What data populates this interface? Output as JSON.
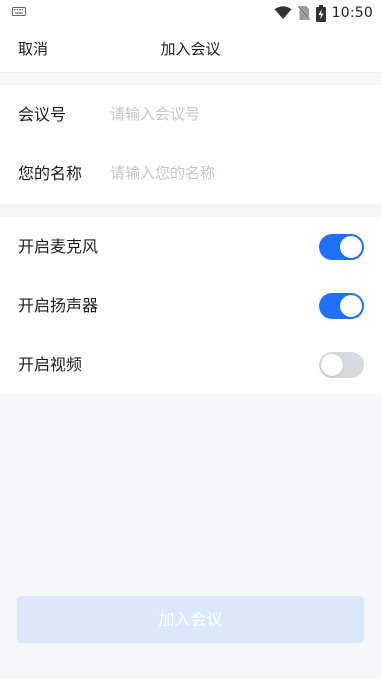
{
  "status_bar": {
    "time": "10:50",
    "icons": [
      "keyboard-icon",
      "wifi-icon",
      "no-sim-icon",
      "battery-charging-icon"
    ]
  },
  "nav": {
    "cancel_label": "取消",
    "title": "加入会议"
  },
  "form": {
    "meeting_id": {
      "label": "会议号",
      "value": "",
      "placeholder": "请输入会议号"
    },
    "name": {
      "label": "您的名称",
      "value": "",
      "placeholder": "请输入您的名称"
    }
  },
  "toggles": [
    {
      "label": "开启麦克风",
      "on": true
    },
    {
      "label": "开启扬声器",
      "on": true
    },
    {
      "label": "开启视频",
      "on": false
    }
  ],
  "join_button": {
    "label": "加入会议",
    "enabled": false
  },
  "colors": {
    "accent": "#1f72ff",
    "switch_off": "#d6d9de",
    "button_disabled": "#dbe7fb",
    "page_background": "#f6f7f9"
  }
}
